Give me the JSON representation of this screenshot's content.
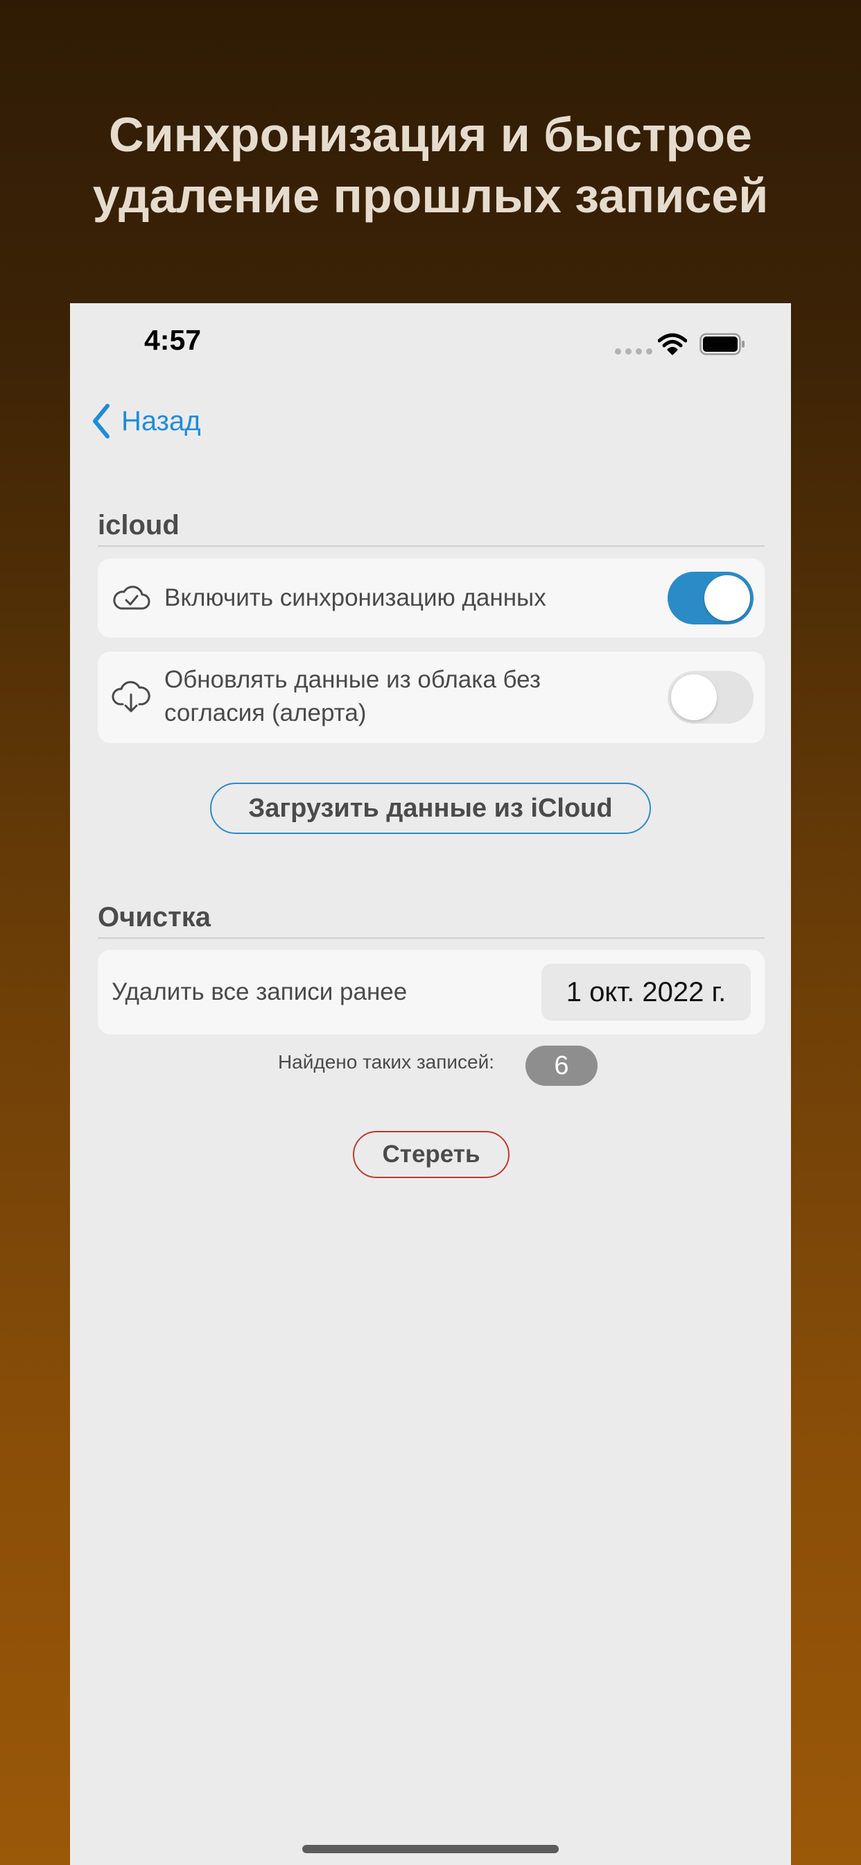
{
  "promo": {
    "title_line1": "Синхронизация и быстрое",
    "title_line2": "удаление прошлых записей"
  },
  "status_bar": {
    "time": "4:57",
    "icons": [
      "signal-dots-icon",
      "wifi-icon",
      "battery-icon"
    ]
  },
  "nav": {
    "back_label": "Назад",
    "back_icon": "chevron-left-icon"
  },
  "colors": {
    "accent": "#1f8cd8",
    "toggle_on": "#2b8bc6",
    "destructive": "#c0392b"
  },
  "icloud": {
    "header": "icloud",
    "sync_label": "Включить синхронизацию данных",
    "sync_icon": "cloud-check-icon",
    "sync_enabled": true,
    "auto_update_label_line1": "Обновлять данные из облака без",
    "auto_update_label_line2": "согласия (алерта)",
    "auto_update_icon": "cloud-download-icon",
    "auto_update_enabled": false,
    "load_button": "Загрузить данные из iCloud"
  },
  "cleanup": {
    "header": "Очистка",
    "delete_label": "Удалить все записи ранее",
    "date_value": "1 окт. 2022 г.",
    "found_label": "Найдено таких записей:",
    "found_count": "6",
    "erase_button": "Стереть"
  }
}
